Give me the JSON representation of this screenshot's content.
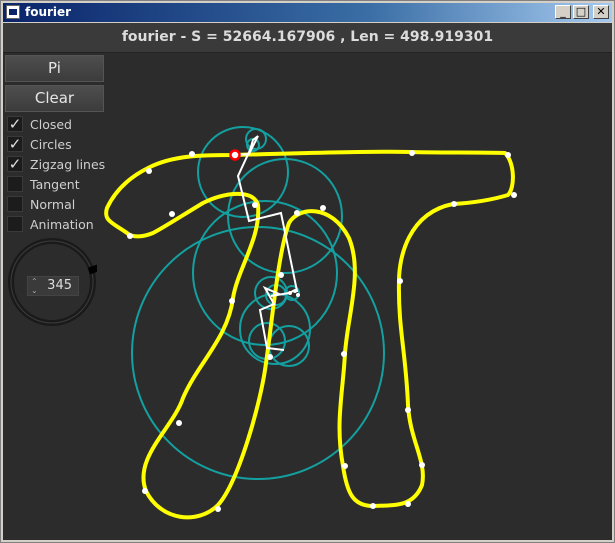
{
  "window": {
    "title": "fourier",
    "minimize_glyph": "_",
    "maximize_glyph": "□",
    "close_glyph": "✕"
  },
  "header": {
    "text": "fourier - S = 52664.167906 , Len = 498.919301"
  },
  "buttons": {
    "pi": "Pi",
    "clear": "Clear"
  },
  "options": [
    {
      "label": "Closed",
      "checked": true
    },
    {
      "label": "Circles",
      "checked": true
    },
    {
      "label": "Zigzag lines",
      "checked": true
    },
    {
      "label": "Tangent",
      "checked": false
    },
    {
      "label": "Normal",
      "checked": false
    },
    {
      "label": "Animation",
      "checked": false
    }
  ],
  "dial": {
    "value": "345"
  },
  "colors": {
    "curve": "#ffff00",
    "circles": "#14a0a0",
    "zigzag": "#ffffff",
    "background": "#2c2c2c",
    "marker": "#ff0000"
  }
}
